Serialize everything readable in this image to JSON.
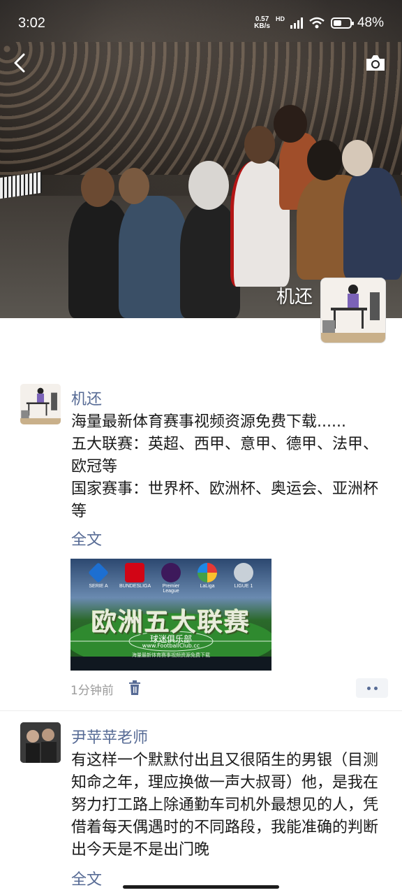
{
  "status_bar": {
    "time": "3:02",
    "net_speed_value": "0.57",
    "net_speed_unit": "KB/s",
    "network_type": "HD",
    "battery_percent": "48%",
    "battery_level": 0.48
  },
  "cover": {
    "profile_name": "机还",
    "back_icon": "chevron-left-icon",
    "camera_icon": "camera-icon"
  },
  "posts": [
    {
      "author": "机还",
      "lines": [
        "海量最新体育赛事视频资源免费下载......",
        "五大联赛：英超、西甲、意甲、德甲、法甲、欧冠等",
        "国家赛事：世界杯、欧洲杯、奥运会、亚洲杯等"
      ],
      "full_text_link": "全文",
      "image": {
        "title": "欧洲五大联赛",
        "club": "球迷俱乐部",
        "url": "www.FootballClub.cc",
        "subtitle": "海量最新体育赛事视频资源免费下载",
        "logos": [
          "SERIE A",
          "BUNDESLIGA",
          "Premier League",
          "LaLiga",
          "LIGUE 1"
        ]
      },
      "time": "1分钟前",
      "delete_icon": "trash-icon",
      "more_icon": "more-dots-icon"
    },
    {
      "author": "尹苹苹老师",
      "text": "有这样一个默默付出且又很陌生的男银（目测知命之年，理应换做一声大叔哥）他，是我在努力打工路上除通勤车司机外最想见的人，凭借着每天偶遇时的不同路段，我能准确的判断出今天是不是出门晚",
      "full_text_link": "全文"
    }
  ],
  "colors": {
    "link": "#576b95",
    "meta": "#9b9b9b",
    "text": "#1a1a1a"
  }
}
